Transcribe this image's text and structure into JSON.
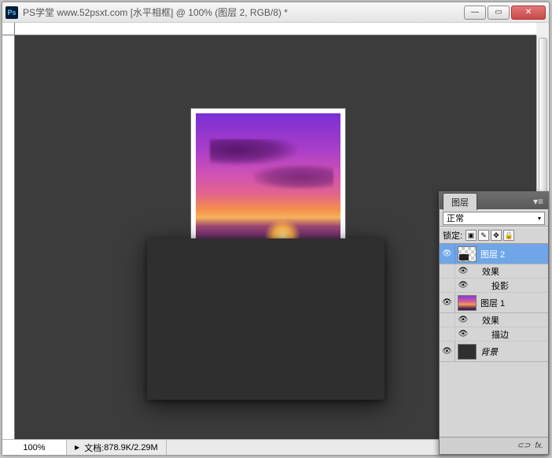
{
  "window": {
    "app_icon_text": "Ps",
    "title": "PS学堂 www.52psxt.com [水平相框] @ 100% (图层 2, RGB/8) *"
  },
  "statusbar": {
    "zoom": "100%",
    "doc_label": "文档:",
    "doc_size": "878.9K/2.29M"
  },
  "layers_panel": {
    "tab": "图层",
    "blend_mode": "正常",
    "lock_label": "锁定:",
    "layers": {
      "l2": "图层 2",
      "l2_fx": "效果",
      "l2_fx_shadow": "投影",
      "l1": "图层 1",
      "l1_fx": "效果",
      "l1_fx_stroke": "描边",
      "bg": "背景"
    },
    "bottom_icons": {
      "link": "⊂⊃",
      "fx": "fx."
    }
  }
}
